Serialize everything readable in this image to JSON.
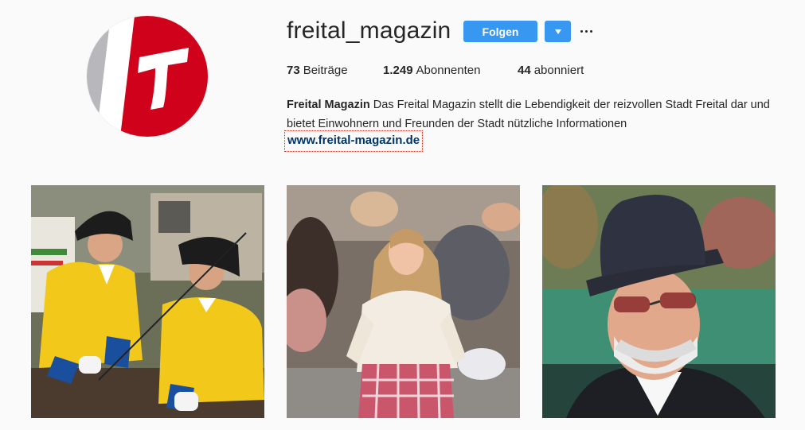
{
  "profile": {
    "username": "freital_magazin",
    "follow_label": "Folgen",
    "avatar_icon": "freital-logo-icon",
    "colors": {
      "accent": "#3897f0",
      "brand_red": "#d0021b",
      "link": "#003569"
    }
  },
  "stats": {
    "posts_count": "73",
    "posts_label": "Beiträge",
    "followers_count": "1.249",
    "followers_label": "Abonnenten",
    "following_count": "44",
    "following_label": "abonniert"
  },
  "bio": {
    "name": "Freital Magazin",
    "text": " Das Freital Magazin stellt die Lebendigkeit der reizvollen Stadt Freital dar und bietet Einwohnern und Freunden der Stadt nützliche Informationen",
    "link": "www.freital-magazin.de"
  },
  "posts": [
    {
      "subject": "two riders in yellow uniforms with black tricorn hats"
    },
    {
      "subject": "girl in white blouse and red checkered skirt"
    },
    {
      "subject": "old man with white beard, top hat and sunglasses"
    }
  ]
}
